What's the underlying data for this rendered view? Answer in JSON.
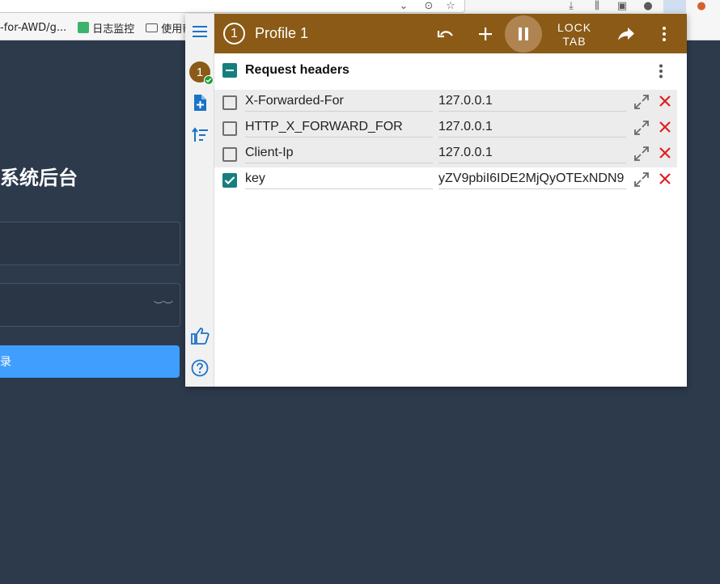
{
  "browser": {
    "bookmarks": [
      {
        "label": "-for-AWD/g..."
      },
      {
        "label": "日志监控"
      },
      {
        "label": "使用帮助"
      }
    ]
  },
  "background_page": {
    "title": "系统后台",
    "login_button_label": "录"
  },
  "popup": {
    "profile_number": "1",
    "profile_title": "Profile 1",
    "lock_tab_line1": "LOCK",
    "lock_tab_line2": "TAB",
    "section_title": "Request headers",
    "headers": [
      {
        "name": "X-Forwarded-For",
        "value": "127.0.0.1",
        "enabled": false
      },
      {
        "name": "HTTP_X_FORWARD_FOR",
        "value": "127.0.0.1",
        "enabled": false
      },
      {
        "name": "Client-Ip",
        "value": "127.0.0.1",
        "enabled": false
      },
      {
        "name": "key",
        "value": "yZV9pbiI6IDE2MjQyOTExNDN9",
        "enabled": true
      }
    ]
  },
  "colors": {
    "profile_brown": "#8a5a16",
    "checkbox_teal": "#177e7e",
    "remove_red": "#e02020",
    "page_background": "#2c3a4c",
    "login_button_blue": "#409eff"
  },
  "icons": {
    "sidebar": [
      "menu-icon",
      "profile-avatar-icon",
      "add-file-icon",
      "sort-icon",
      "thumbs-up-icon",
      "help-icon"
    ],
    "toolbar": [
      "undo-icon",
      "add-icon",
      "pause-icon",
      "share-icon",
      "more-vert-icon"
    ],
    "row": [
      "expand-icon",
      "remove-icon"
    ]
  }
}
